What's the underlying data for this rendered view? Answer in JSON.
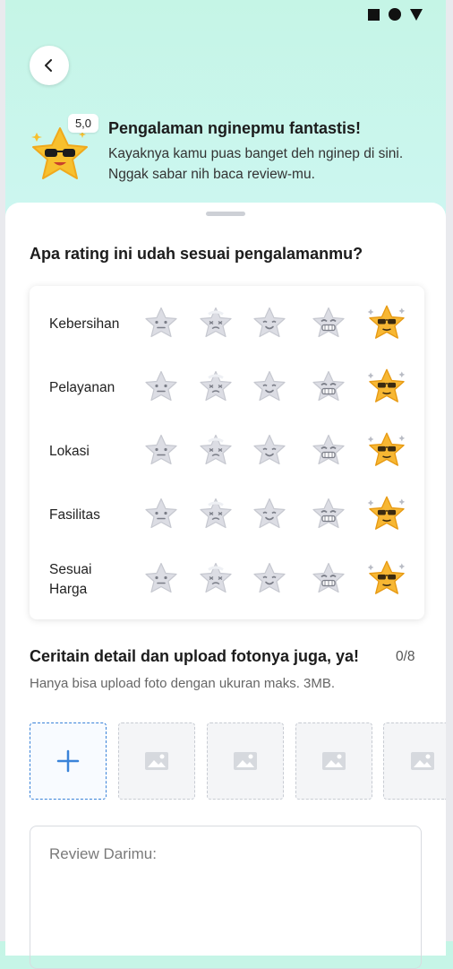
{
  "header": {
    "score": "5,0",
    "title": "Pengalaman nginepmu fantastis!",
    "subtitle": "Kayaknya kamu puas banget deh nginep di sini. Nggak sabar nih baca review-mu."
  },
  "rating_section": {
    "question": "Apa rating ini udah sesuai pengalamanmu?",
    "face_icons": [
      "plain-star-face-icon",
      "sweaty-star-face-icon",
      "smiling-star-face-icon",
      "grinning-star-face-icon",
      "sunglasses-star-face-icon"
    ],
    "selected_color": "#f7b733",
    "unselected_color": "#dcdde4",
    "rows": [
      {
        "label": "Kebersihan",
        "selected": 4
      },
      {
        "label": "Pelayanan",
        "selected": 4
      },
      {
        "label": "Lokasi",
        "selected": 4
      },
      {
        "label": "Fasilitas",
        "selected": 4
      },
      {
        "label": "Sesuai\nHarga",
        "selected": 4
      }
    ]
  },
  "upload_section": {
    "title": "Ceritain detail dan upload fotonya juga, ya!",
    "counter": "0/8",
    "hint": "Hanya bisa upload foto dengan ukuran maks. 3MB.",
    "add_icon": "plus-icon",
    "placeholder_icon": "image-placeholder-icon"
  },
  "review": {
    "placeholder": "Review Darimu:"
  },
  "colors": {
    "accent": "#3a83d9",
    "star": "#f7b733"
  }
}
